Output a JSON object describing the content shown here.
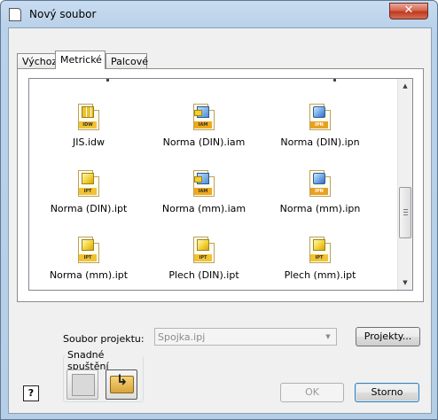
{
  "window": {
    "title": "Nový soubor",
    "close_glyph": "✕"
  },
  "tabs": [
    {
      "label": "Výchozí",
      "active": false
    },
    {
      "label": "Metrické",
      "active": true
    },
    {
      "label": "Palcové",
      "active": false
    }
  ],
  "files": [
    {
      "name": "JIS.idw",
      "ext": "IDW",
      "icon": "drawing-icon"
    },
    {
      "name": "Norma (DIN).iam",
      "ext": "IAM",
      "icon": "assembly-icon"
    },
    {
      "name": "Norma (DIN).ipn",
      "ext": "IPN",
      "icon": "presentation-icon"
    },
    {
      "name": "Norma (DIN).ipt",
      "ext": "IPT",
      "icon": "part-icon"
    },
    {
      "name": "Norma (mm).iam",
      "ext": "IAM",
      "icon": "assembly-icon"
    },
    {
      "name": "Norma (mm).ipn",
      "ext": "IPN",
      "icon": "presentation-icon"
    },
    {
      "name": "Norma (mm).ipt",
      "ext": "IPT",
      "icon": "part-icon"
    },
    {
      "name": "Plech (DIN).ipt",
      "ext": "IPT",
      "icon": "sheet-metal-icon"
    },
    {
      "name": "Plech (mm).ipt",
      "ext": "IPT",
      "icon": "sheet-metal-icon"
    }
  ],
  "project": {
    "label": "Soubor projektu:",
    "value": "Spojka.ipj",
    "browse_label": "Projekty..."
  },
  "quick_launch": {
    "label": "Snadné spuštění"
  },
  "buttons": {
    "ok": "OK",
    "cancel": "Storno",
    "help": "?"
  },
  "scrollbar": {
    "up": "▲",
    "down": "▼"
  }
}
